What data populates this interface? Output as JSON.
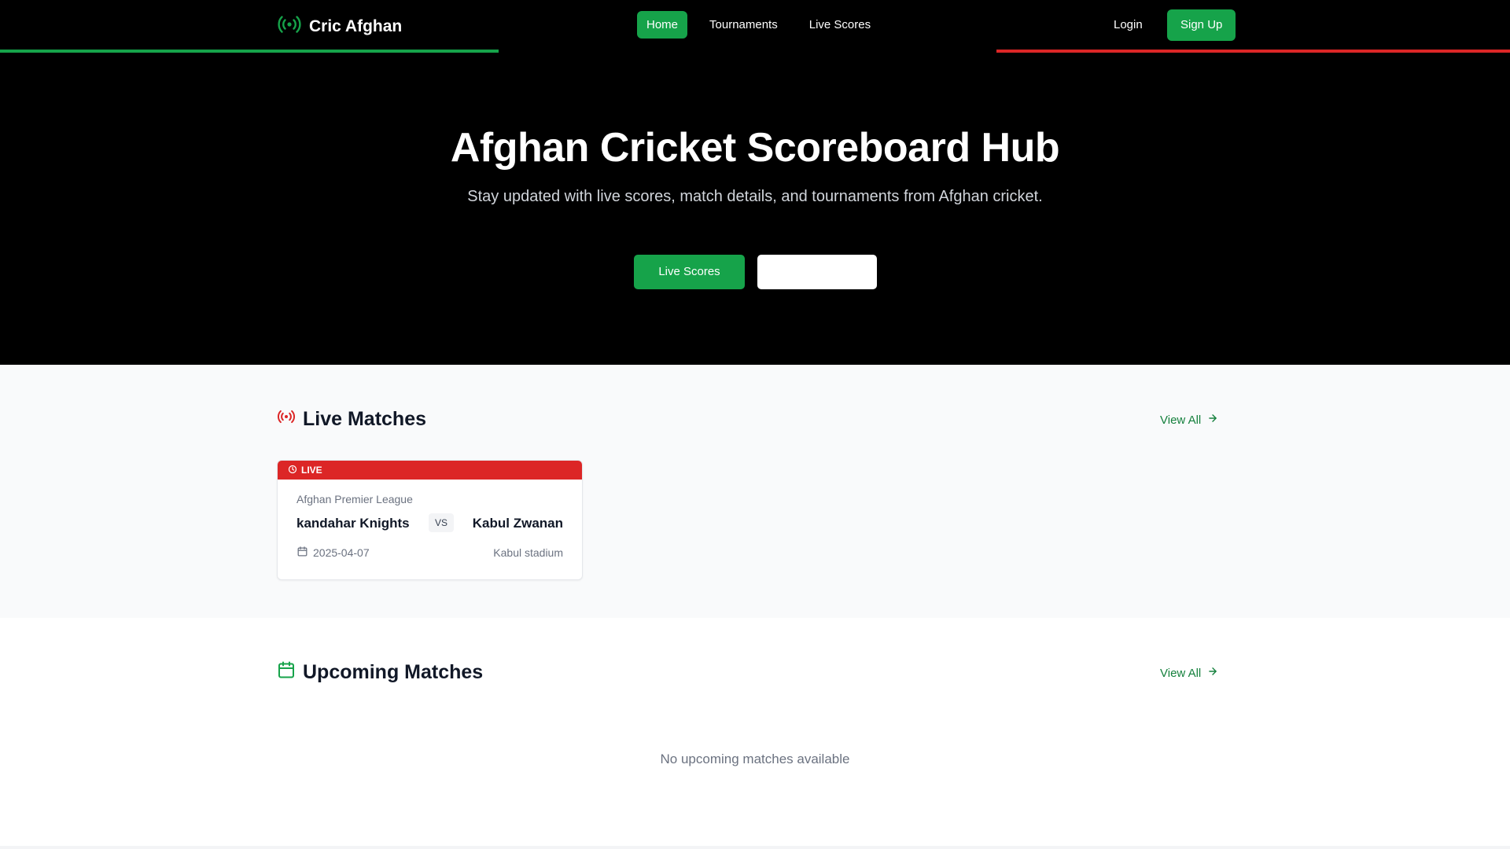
{
  "navbar": {
    "brand": "Cric Afghan",
    "links": [
      "Home",
      "Tournaments",
      "Live Scores"
    ],
    "active_link": "Home",
    "login_label": "Login",
    "signup_label": "Sign Up",
    "icon": "radio-broadcast-icon"
  },
  "colors": {
    "brand_green": "#16a34a",
    "accent_red": "#dc2626",
    "hero_bg": "#000000"
  },
  "hero": {
    "title": "Afghan Cricket Scoreboard Hub",
    "subtitle": "Stay updated with live scores, match details, and tournaments from Afghan cricket.",
    "primary_button": "Live Scores",
    "secondary_button": ""
  },
  "live_matches": {
    "heading": "Live Matches",
    "heading_icon": "radio-broadcast-icon",
    "view_all": "View All",
    "matches": [
      {
        "status": "LIVE",
        "league": "Afghan Premier League",
        "team_a": "kandahar Knights",
        "vs": "VS",
        "team_b": "Kabul Zwanan",
        "date": "2025-04-07",
        "venue": "Kabul stadium"
      }
    ]
  },
  "upcoming_matches": {
    "heading": "Upcoming Matches",
    "heading_icon": "calendar-icon",
    "view_all": "View All",
    "empty_message": "No upcoming matches available"
  }
}
